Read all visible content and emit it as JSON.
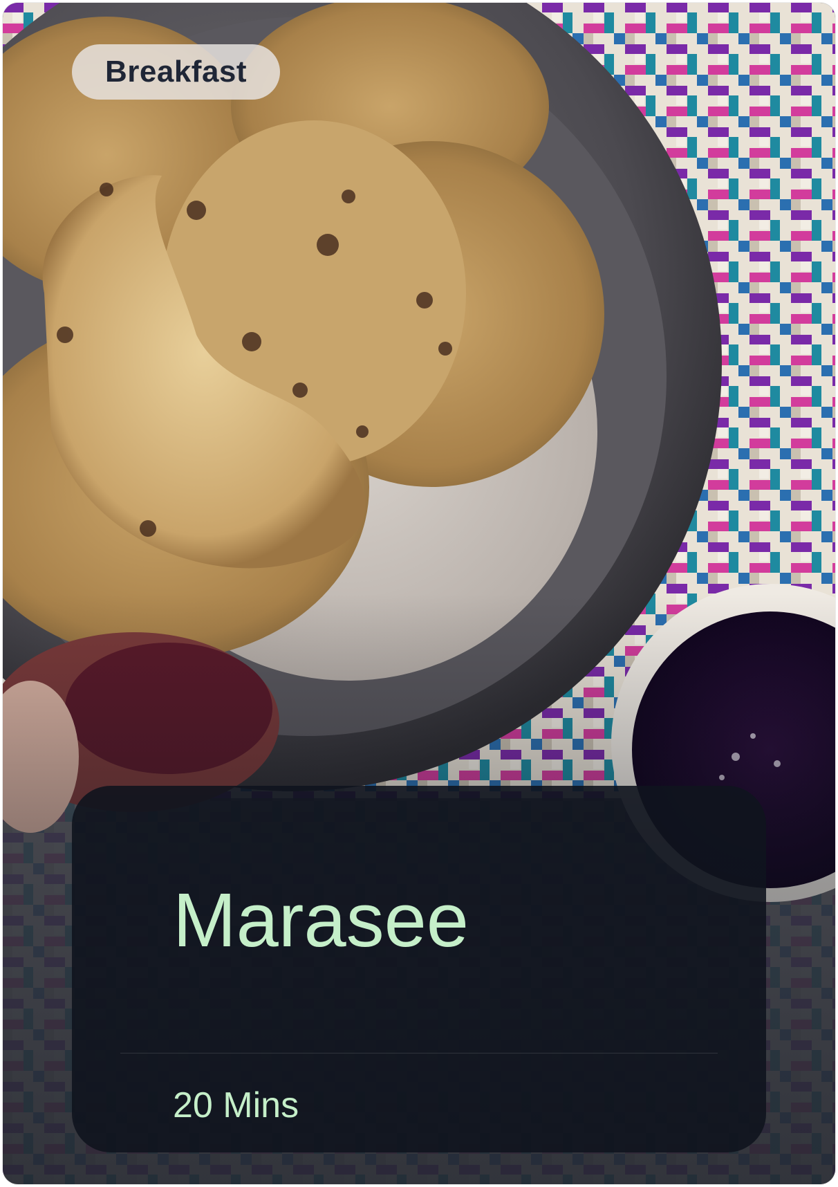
{
  "card": {
    "category_label": "Breakfast",
    "title": "Marasee",
    "duration": "20 Mins"
  },
  "colors": {
    "title_text": "#c5efc9",
    "badge_text": "#1f2636",
    "badge_background": "#e6e2de",
    "panel_background": "#10141e"
  }
}
